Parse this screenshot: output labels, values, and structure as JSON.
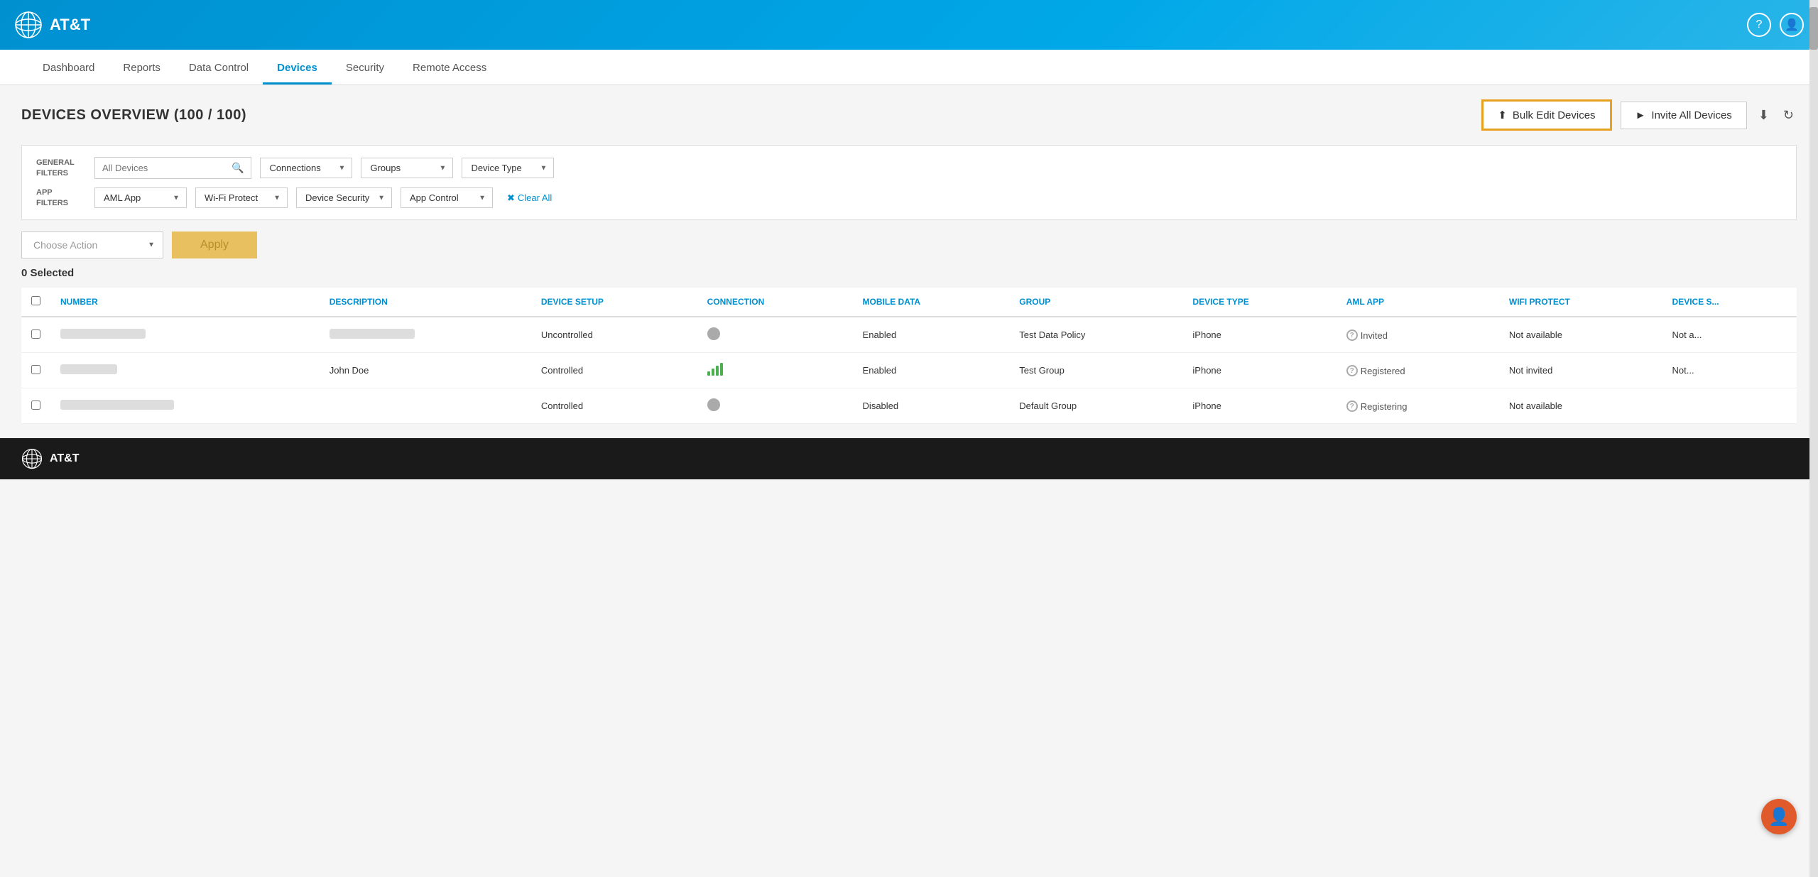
{
  "header": {
    "brand": "AT&T",
    "help_icon": "?",
    "user_icon": "👤"
  },
  "nav": {
    "items": [
      {
        "label": "Dashboard",
        "active": false
      },
      {
        "label": "Reports",
        "active": false
      },
      {
        "label": "Data Control",
        "active": false
      },
      {
        "label": "Devices",
        "active": true
      },
      {
        "label": "Security",
        "active": false
      },
      {
        "label": "Remote Access",
        "active": false
      }
    ]
  },
  "overview": {
    "title": "DEVICES OVERVIEW (100 / 100)",
    "bulk_edit_label": "Bulk Edit Devices",
    "invite_all_label": "Invite All Devices"
  },
  "general_filters": {
    "label": "GENERAL FILTERS",
    "search_placeholder": "All Devices",
    "connections_label": "Connections",
    "groups_label": "Groups",
    "device_type_label": "Device Type"
  },
  "app_filters": {
    "label": "APP FILTERS",
    "aml_app_label": "AML App",
    "wifi_protect_label": "Wi-Fi Protect",
    "device_security_label": "Device Security",
    "app_control_label": "App Control",
    "clear_all_label": "Clear All"
  },
  "action_bar": {
    "choose_action_placeholder": "Choose Action",
    "apply_label": "Apply"
  },
  "table": {
    "selected_count": "0",
    "selected_label": "Selected",
    "columns": [
      {
        "key": "number",
        "label": "NUMBER"
      },
      {
        "key": "description",
        "label": "DESCRIPTION"
      },
      {
        "key": "device_setup",
        "label": "DEVICE SETUP"
      },
      {
        "key": "connection",
        "label": "CONNECTION"
      },
      {
        "key": "mobile_data",
        "label": "MOBILE DATA"
      },
      {
        "key": "group",
        "label": "GROUP"
      },
      {
        "key": "device_type",
        "label": "DEVICE TYPE"
      },
      {
        "key": "aml_app",
        "label": "AML APP"
      },
      {
        "key": "wifi_protect",
        "label": "WIFI PROTECT"
      },
      {
        "key": "device_s",
        "label": "DEVICE S..."
      }
    ],
    "rows": [
      {
        "number_blurred": true,
        "description_blurred": true,
        "device_setup": "Uncontrolled",
        "connection": "grey",
        "mobile_data": "Enabled",
        "group": "Test Data Policy",
        "device_type": "iPhone",
        "aml_app": "Invited",
        "wifi_protect": "Not available",
        "device_s": "Not a..."
      },
      {
        "number_blurred": true,
        "description": "John Doe",
        "device_setup": "Controlled",
        "connection": "bars",
        "mobile_data": "Enabled",
        "group": "Test Group",
        "device_type": "iPhone",
        "aml_app": "Registered",
        "wifi_protect": "Not invited",
        "device_s": "Not..."
      },
      {
        "number_blurred_lg": true,
        "description_blurred": false,
        "device_setup": "Controlled",
        "connection": "grey",
        "mobile_data": "Disabled",
        "group": "Default Group",
        "device_type": "iPhone",
        "aml_app": "Registering",
        "wifi_protect": "Not available",
        "device_s": ""
      }
    ]
  },
  "footer": {
    "brand": "AT&T"
  }
}
